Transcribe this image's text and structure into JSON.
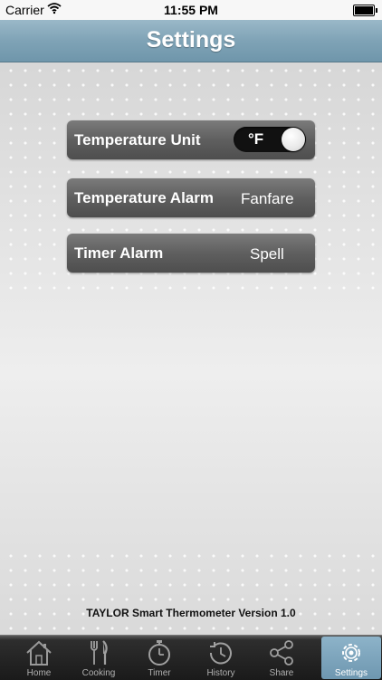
{
  "status_bar": {
    "carrier": "Carrier",
    "time": "11:55 PM"
  },
  "nav": {
    "title": "Settings"
  },
  "settings": {
    "temperature_unit": {
      "label": "Temperature Unit",
      "toggle_value": "°F"
    },
    "temperature_alarm": {
      "label": "Temperature Alarm",
      "value": "Fanfare"
    },
    "timer_alarm": {
      "label": "Timer Alarm",
      "value": "Spell"
    }
  },
  "footer": {
    "version_text": "TAYLOR Smart Thermometer Version 1.0"
  },
  "tabs": [
    {
      "label": "Home",
      "icon": "home-icon"
    },
    {
      "label": "Cooking",
      "icon": "fork-knife-icon"
    },
    {
      "label": "Timer",
      "icon": "stopwatch-icon"
    },
    {
      "label": "History",
      "icon": "history-clock-icon"
    },
    {
      "label": "Share",
      "icon": "share-icon"
    },
    {
      "label": "Settings",
      "icon": "gear-icon",
      "active": true
    }
  ],
  "colors": {
    "nav_bar": "#7fa3b6",
    "active_tab": "#7ea6bd",
    "row_background": "#5f5f5f"
  }
}
